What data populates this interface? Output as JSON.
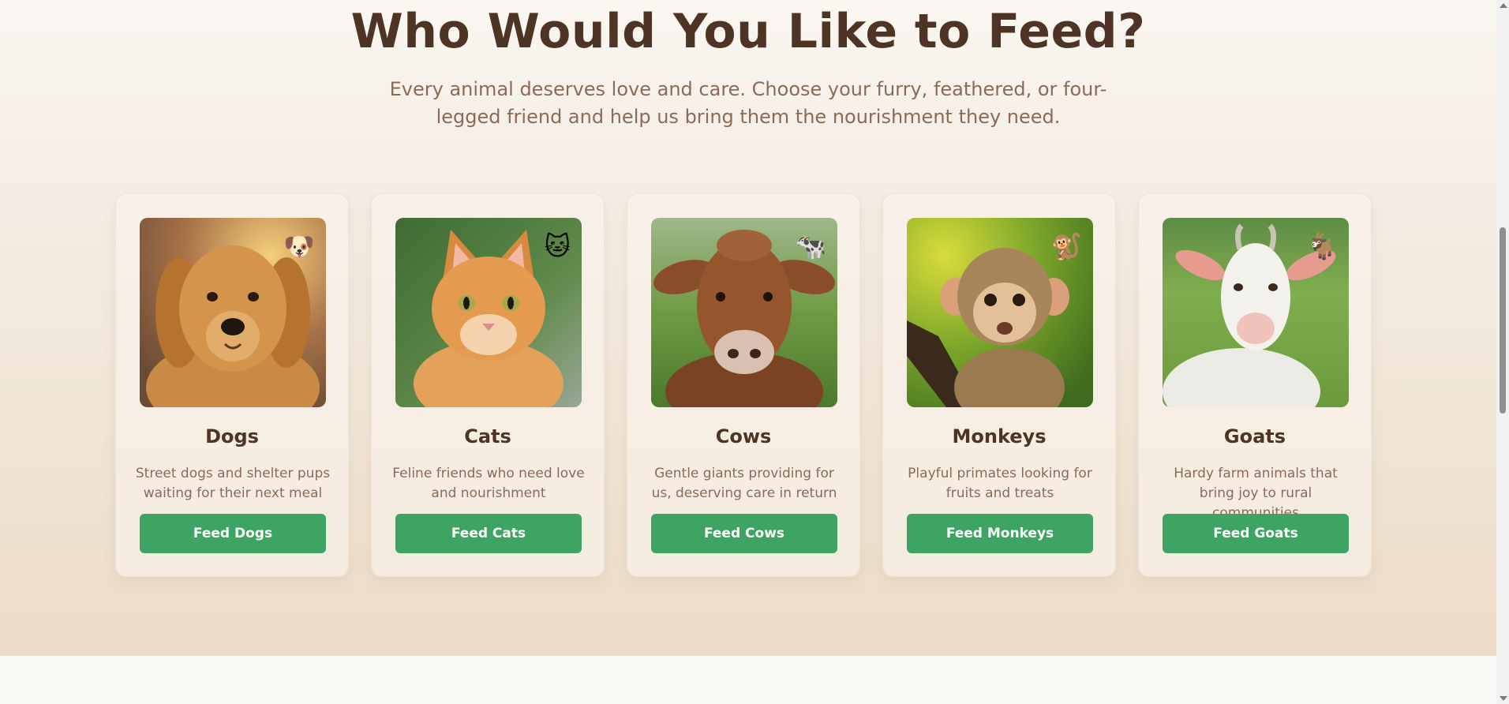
{
  "section": {
    "title": "Who Would You Like to Feed?",
    "subtitle": "Every animal deserves love and care. Choose your furry, feathered, or four-legged friend and help us bring them the nourishment they need."
  },
  "animals": [
    {
      "name": "Dogs",
      "description": "Street dogs and shelter pups waiting for their next meal",
      "button_label": "Feed Dogs",
      "badge": "🐶",
      "icon": "dog-face-icon"
    },
    {
      "name": "Cats",
      "description": "Feline friends who need love and nourishment",
      "button_label": "Feed Cats",
      "badge": "🐱",
      "icon": "cat-face-icon"
    },
    {
      "name": "Cows",
      "description": "Gentle giants providing for us, deserving care in return",
      "button_label": "Feed Cows",
      "badge": "🐄",
      "icon": "cow-icon"
    },
    {
      "name": "Monkeys",
      "description": "Playful primates looking for fruits and treats",
      "button_label": "Feed Monkeys",
      "badge": "🐒",
      "icon": "monkey-icon"
    },
    {
      "name": "Goats",
      "description": "Hardy farm animals that bring joy to rural communities",
      "button_label": "Feed Goats",
      "badge": "🐐",
      "icon": "goat-icon"
    }
  ],
  "colors": {
    "heading": "#4e3424",
    "body_text": "#8a6b58",
    "button": "#3ea463",
    "button_text": "#ffffff"
  }
}
